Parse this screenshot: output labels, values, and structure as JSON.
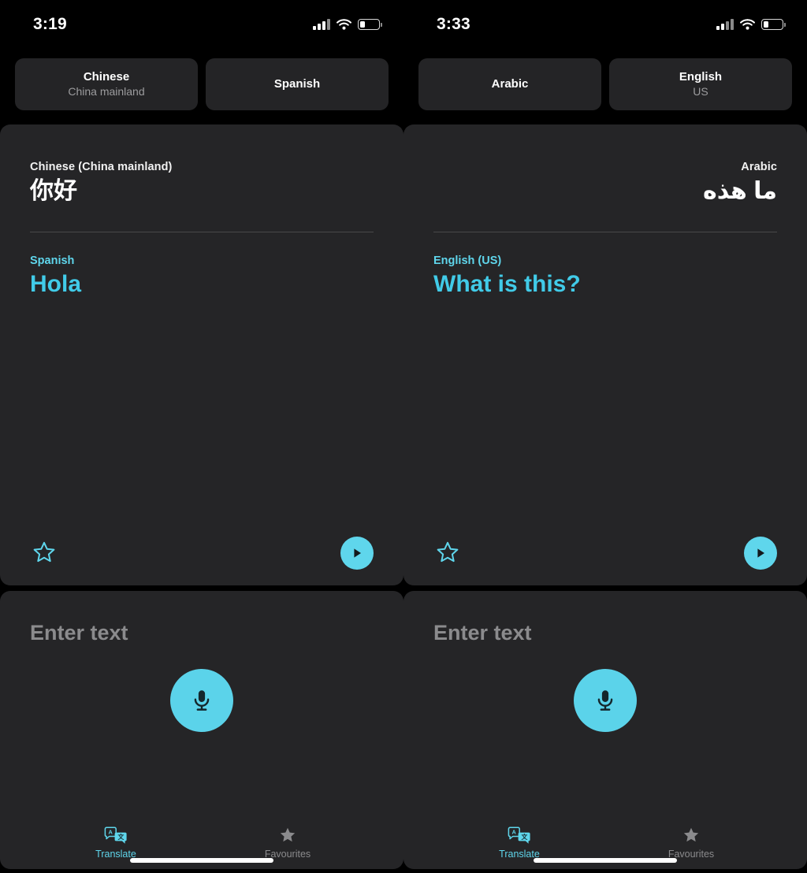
{
  "accent": "#5FD6EC",
  "card_bg": "#252527",
  "page_bg": "#000000",
  "screens": [
    {
      "id": "left",
      "statusbar": {
        "time": "3:19",
        "signal_icon": "cellular-signal-icon",
        "wifi_icon": "wifi-icon",
        "battery_icon": "battery-low-icon"
      },
      "language_selector": {
        "source": {
          "name": "Chinese",
          "region": "China mainland"
        },
        "target": {
          "name": "Spanish",
          "region": ""
        }
      },
      "card": {
        "rtl": false,
        "source_label": "Chinese (China mainland)",
        "source_text": "你好",
        "target_label": "Spanish",
        "target_text": "Hola",
        "favourite_icon": "star-outline-icon",
        "play_icon": "play-icon"
      },
      "compose": {
        "placeholder": "Enter text",
        "mic_icon": "microphone-icon"
      },
      "tabs": [
        {
          "label": "Translate",
          "icon": "translate-icon",
          "active": true
        },
        {
          "label": "Favourites",
          "icon": "star-filled-icon",
          "active": false
        }
      ]
    },
    {
      "id": "right",
      "statusbar": {
        "time": "3:33",
        "signal_icon": "cellular-signal-icon",
        "wifi_icon": "wifi-icon",
        "battery_icon": "battery-low-icon"
      },
      "language_selector": {
        "source": {
          "name": "Arabic",
          "region": ""
        },
        "target": {
          "name": "English",
          "region": "US"
        }
      },
      "card": {
        "rtl": true,
        "source_label": "Arabic",
        "source_text": "ما هذه",
        "target_label": "English (US)",
        "target_text": "What is this?",
        "favourite_icon": "star-outline-icon",
        "play_icon": "play-icon"
      },
      "compose": {
        "placeholder": "Enter text",
        "mic_icon": "microphone-icon"
      },
      "tabs": [
        {
          "label": "Translate",
          "icon": "translate-icon",
          "active": true
        },
        {
          "label": "Favourites",
          "icon": "star-filled-icon",
          "active": false
        }
      ]
    }
  ]
}
